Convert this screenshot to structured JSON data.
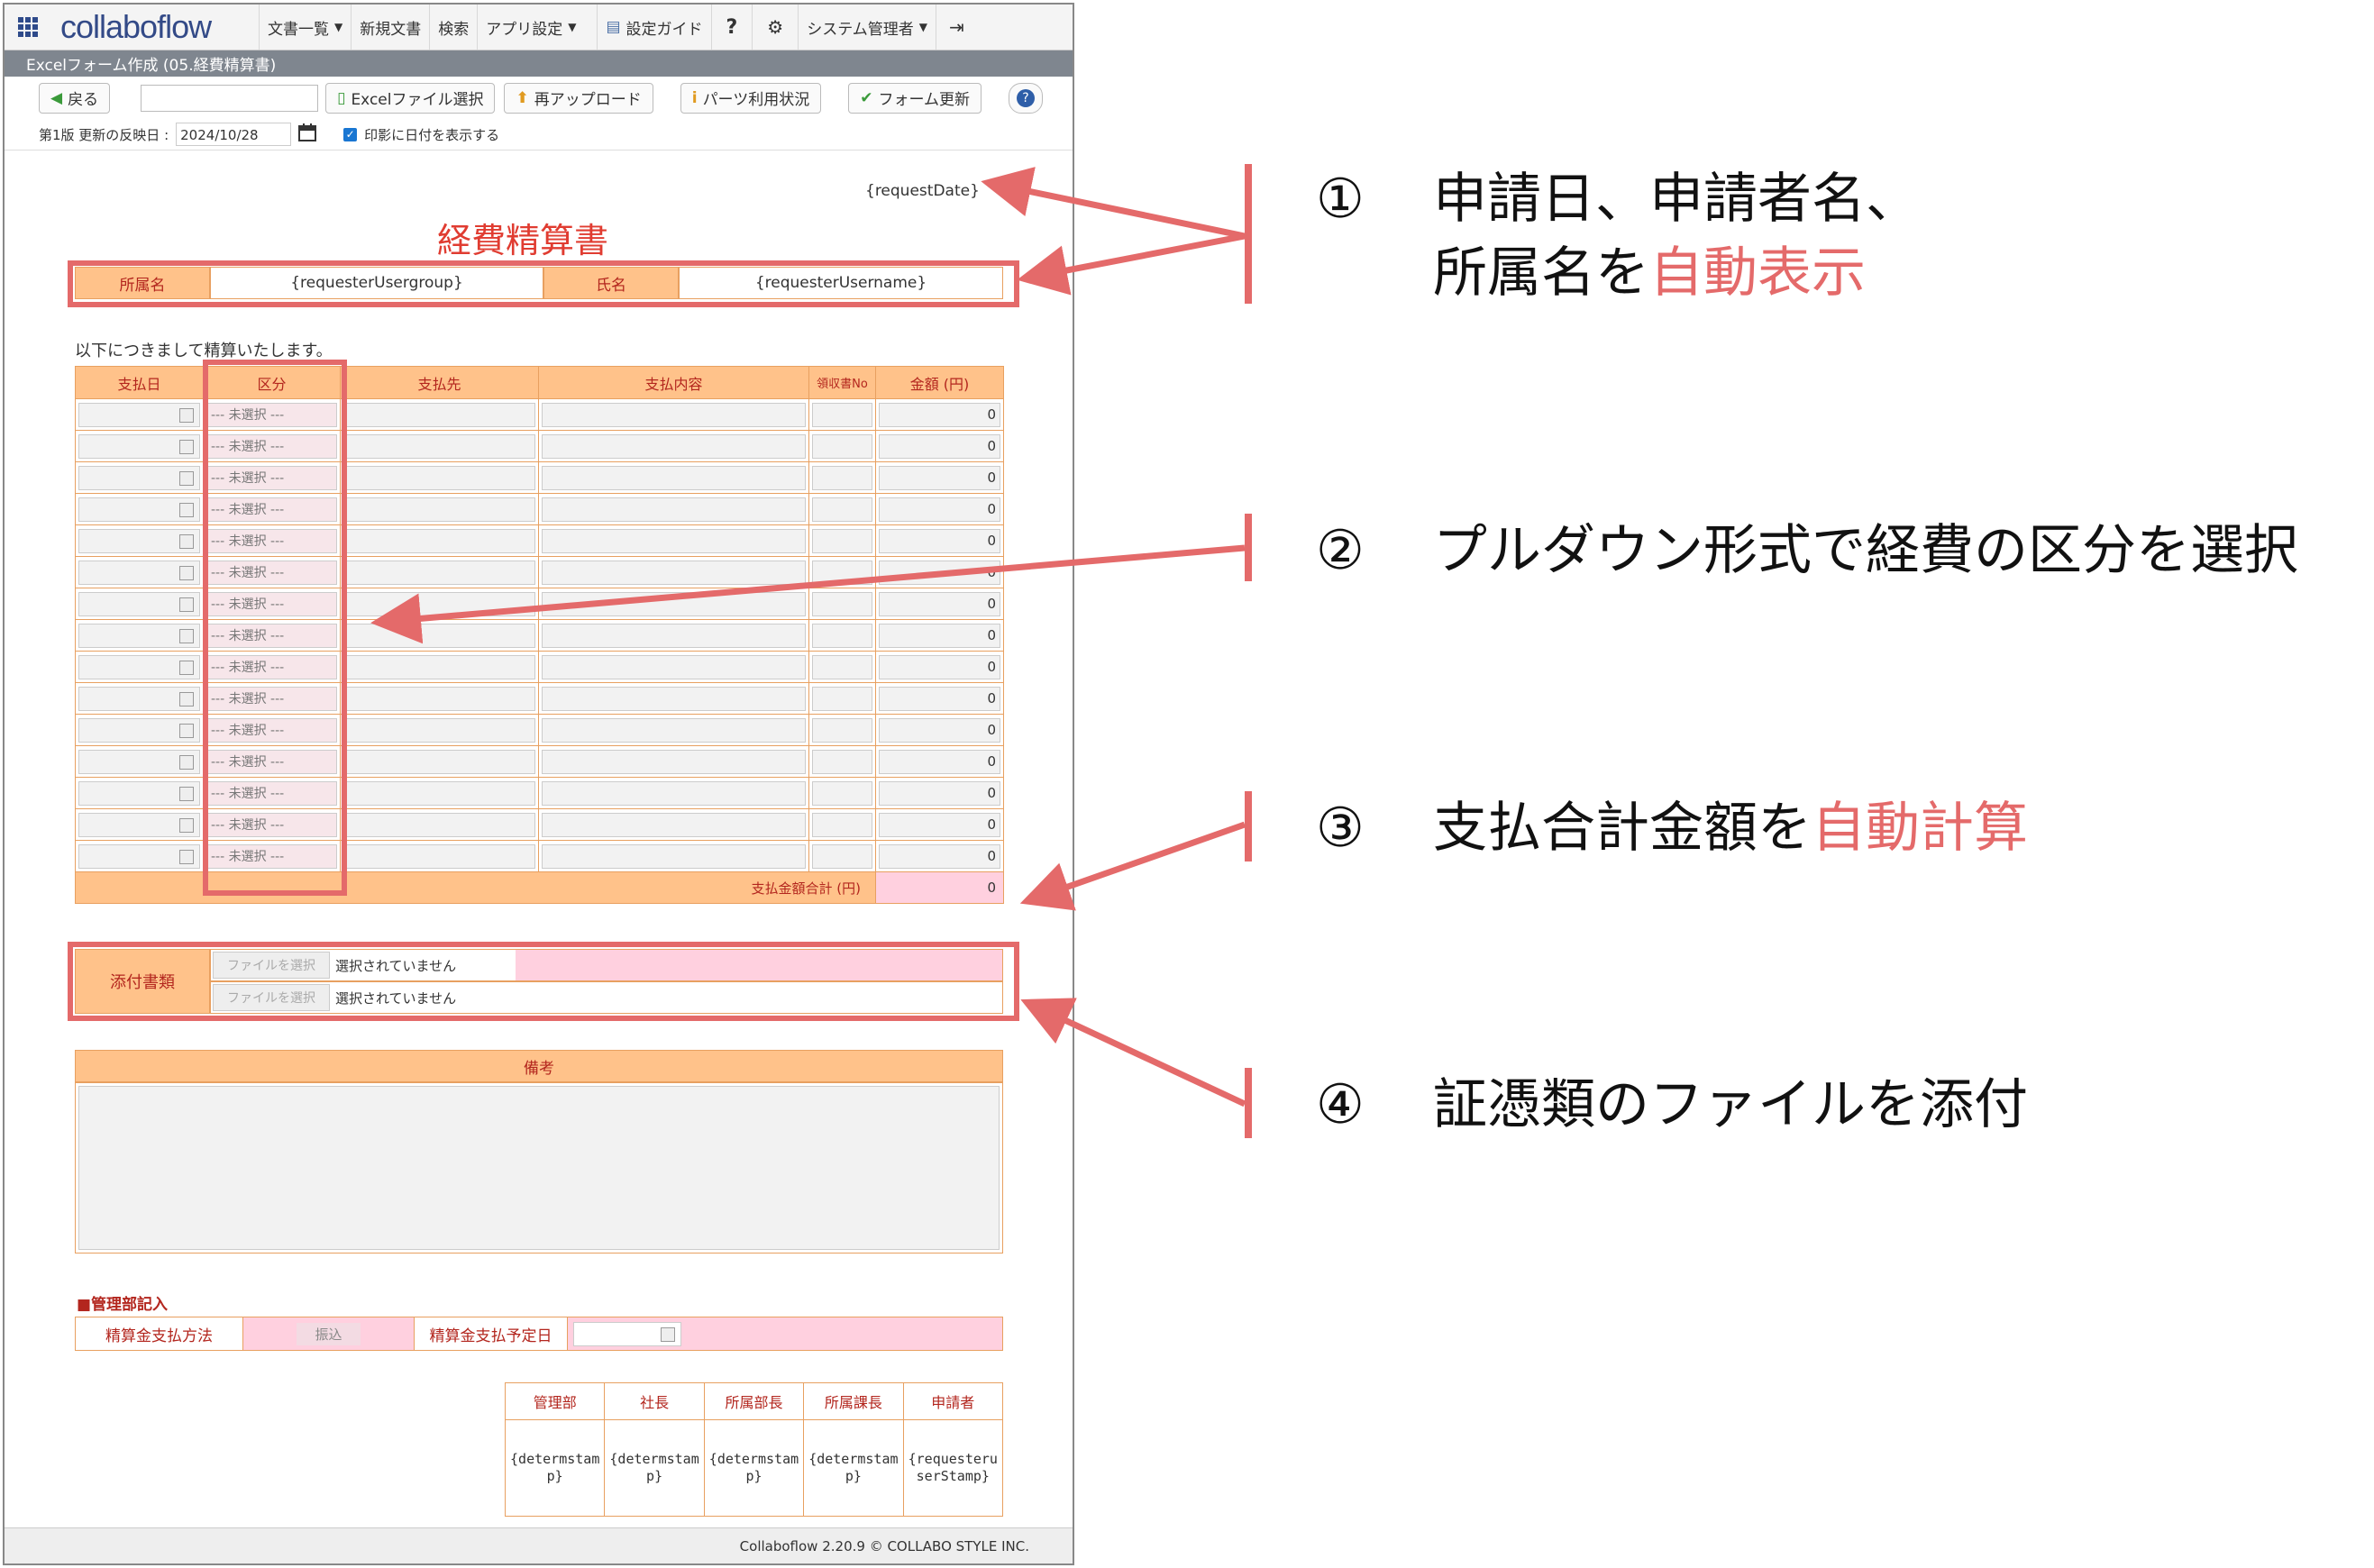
{
  "topbar": {
    "logo": "collaboflow",
    "nav": [
      {
        "label": "文書一覧",
        "dropdown": true
      },
      {
        "label": "新規文書",
        "dropdown": false
      },
      {
        "label": "検索",
        "dropdown": false
      },
      {
        "label": "アプリ設定",
        "dropdown": true
      },
      {
        "label": "設定ガイド",
        "dropdown": false
      },
      {
        "label": "?",
        "dropdown": false
      },
      {
        "label": "",
        "dropdown": false
      },
      {
        "label": "システム管理者",
        "dropdown": true
      },
      {
        "label": "",
        "dropdown": false
      }
    ]
  },
  "subbar": {
    "title": "Excelフォーム作成 (05.経費精算書)"
  },
  "toolbar": {
    "back": "戻る",
    "excel_select": "Excelファイル選択",
    "reupload": "再アップロード",
    "parts_usage": "パーツ利用状況",
    "form_update": "フォーム更新"
  },
  "options": {
    "version_label": "第1版 更新の反映日 :",
    "date_value": "2024/10/28",
    "print_date_label": "印影に日付を表示する"
  },
  "form": {
    "request_date": "{requestDate}",
    "title": "経費精算書",
    "dept_label": "所属名",
    "dept_value": "{requesterUsergroup}",
    "name_label": "氏名",
    "name_value": "{requesterUsername}",
    "intro": "以下につきまして精算いたします。",
    "columns": [
      "支払日",
      "区分",
      "支払先",
      "支払内容",
      "領収書No",
      "金額 (円)"
    ],
    "category_placeholder": "--- 未選択 ---",
    "amount_default": "0",
    "total_label": "支払金額合計 (円)",
    "total_value": "0",
    "attach_label": "添付書類",
    "file_button": "ファイルを選択",
    "file_status": "選択されていません",
    "remarks_label": "備考",
    "mgmt_title": "■管理部記入",
    "payment_method_label": "精算金支払方法",
    "payment_method_value": "振込",
    "payment_date_label": "精算金支払予定日",
    "stamps": [
      {
        "label": "管理部",
        "value": "{determstamp}"
      },
      {
        "label": "社長",
        "value": "{determstamp}"
      },
      {
        "label": "所属部長",
        "value": "{determstamp}"
      },
      {
        "label": "所属課長",
        "value": "{determstamp}"
      },
      {
        "label": "申請者",
        "value": "{requesteruserStamp}"
      }
    ]
  },
  "footer": {
    "text": "Collaboflow 2.20.9 © COLLABO STYLE INC."
  },
  "annotations": [
    {
      "num": "①",
      "line1": "申請日、申請者名、",
      "line2_plain": "所属名を",
      "line2_red": "自動表示"
    },
    {
      "num": "②",
      "text": "プルダウン形式で経費の区分を選択"
    },
    {
      "num": "③",
      "plain": "支払合計金額を",
      "red": "自動計算"
    },
    {
      "num": "④",
      "text": "証憑類のファイルを添付"
    }
  ],
  "colors": {
    "accent_red": "#e46a6a",
    "header_orange": "#ffc28a",
    "title_red": "#e03c31"
  }
}
